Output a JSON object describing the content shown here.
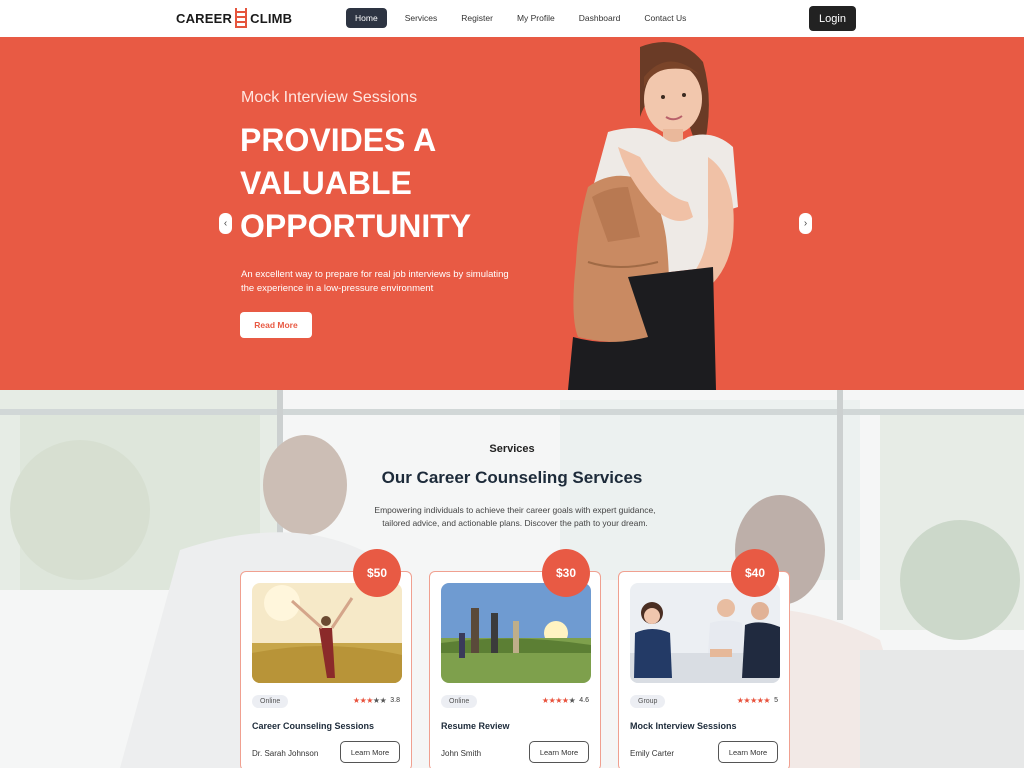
{
  "nav": {
    "logo_left": "CAREER",
    "logo_right": "CLIMB",
    "links": [
      "Home",
      "Services",
      "Register",
      "My Profile",
      "Dashboard",
      "Contact Us"
    ],
    "login": "Login"
  },
  "hero": {
    "subtitle": "Mock Interview Sessions",
    "title_line1": "PROVIDES A",
    "title_line2": "VALUABLE",
    "title_line3": "OPPORTUNITY",
    "text": "An excellent way to prepare for real job interviews by simulating the experience in a low-pressure environment",
    "button": "Read More",
    "arrow_left": "‹",
    "arrow_right": "›"
  },
  "services": {
    "kicker": "Services",
    "title": "Our Career Counseling Services",
    "description": "Empowering individuals to achieve their career goals with expert guidance, tailored advice, and actionable plans. Discover the path to your dream.",
    "cards": [
      {
        "price": "$50",
        "mode": "Online",
        "stars_filled": "★★★",
        "stars_empty": "★★",
        "rating": "3.8",
        "title": "Career Counseling Sessions",
        "author": "Dr. Sarah Johnson",
        "button": "Learn More"
      },
      {
        "price": "$30",
        "mode": "Online",
        "stars_filled": "★★★★",
        "stars_empty": "★",
        "rating": "4.6",
        "title": "Resume Review",
        "author": "John Smith",
        "button": "Learn More"
      },
      {
        "price": "$40",
        "mode": "Group",
        "stars_filled": "★★★★★",
        "stars_empty": "",
        "rating": "5",
        "title": "Mock Interview Sessions",
        "author": "Emily Carter",
        "button": "Learn More"
      }
    ]
  },
  "colors": {
    "accent": "#e85a44",
    "dark": "#2d3442"
  }
}
